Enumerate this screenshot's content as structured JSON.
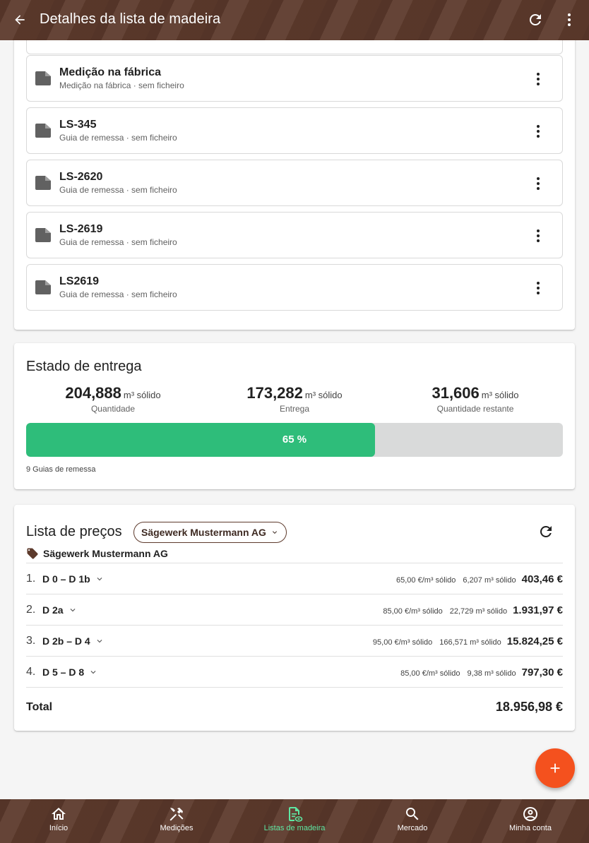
{
  "header": {
    "title": "Detalhes da lista de madeira"
  },
  "documents": [
    {
      "title": "Medição na fábrica",
      "subtitle": "Medição na fábrica · sem ficheiro"
    },
    {
      "title": "LS-345",
      "subtitle": "Guia de remessa · sem ficheiro"
    },
    {
      "title": "LS-2620",
      "subtitle": "Guia de remessa · sem ficheiro"
    },
    {
      "title": "LS-2619",
      "subtitle": "Guia de remessa · sem ficheiro"
    },
    {
      "title": "LS2619",
      "subtitle": "Guia de remessa · sem ficheiro"
    }
  ],
  "delivery": {
    "title": "Estado de entrega",
    "stats": [
      {
        "value": "204,888",
        "unit": "m³ sólido",
        "label": "Quantidade"
      },
      {
        "value": "173,282",
        "unit": "m³ sólido",
        "label": "Entrega"
      },
      {
        "value": "31,606",
        "unit": "m³ sólido",
        "label": "Quantidade restante"
      }
    ],
    "progress_percent": 65,
    "progress_label": "65 %",
    "note": "9 Guias de remessa"
  },
  "pricelist": {
    "title": "Lista de preços",
    "supplier_select": "Sägewerk Mustermann AG",
    "supplier_name": "Sägewerk Mustermann AG",
    "rows": [
      {
        "index": "1.",
        "grade": "D 0 – D 1b",
        "rate": "65,00 €/m³ sólido",
        "volume": "6,207 m³ sólido",
        "amount": "403,46 €"
      },
      {
        "index": "2.",
        "grade": "D 2a",
        "rate": "85,00 €/m³ sólido",
        "volume": "22,729 m³ sólido",
        "amount": "1.931,97 €"
      },
      {
        "index": "3.",
        "grade": "D 2b – D 4",
        "rate": "95,00 €/m³ sólido",
        "volume": "166,571 m³ sólido",
        "amount": "15.824,25 €"
      },
      {
        "index": "4.",
        "grade": "D 5 – D 8",
        "rate": "85,00 €/m³ sólido",
        "volume": "9,38 m³ sólido",
        "amount": "797,30 €"
      }
    ],
    "total_label": "Total",
    "total_value": "18.956,98 €"
  },
  "nav": [
    {
      "label": "Início",
      "icon": "home-icon"
    },
    {
      "label": "Medições",
      "icon": "hammer-pick-icon"
    },
    {
      "label": "Listas de madeira",
      "icon": "wood-list-icon"
    },
    {
      "label": "Mercado",
      "icon": "search-icon"
    },
    {
      "label": "Minha conta",
      "icon": "account-circle-icon"
    }
  ],
  "colors": {
    "brand": "#5d3a2c",
    "progress": "#2ebd7a",
    "fab": "#f4511e",
    "nav_active": "#5ee8a3"
  }
}
